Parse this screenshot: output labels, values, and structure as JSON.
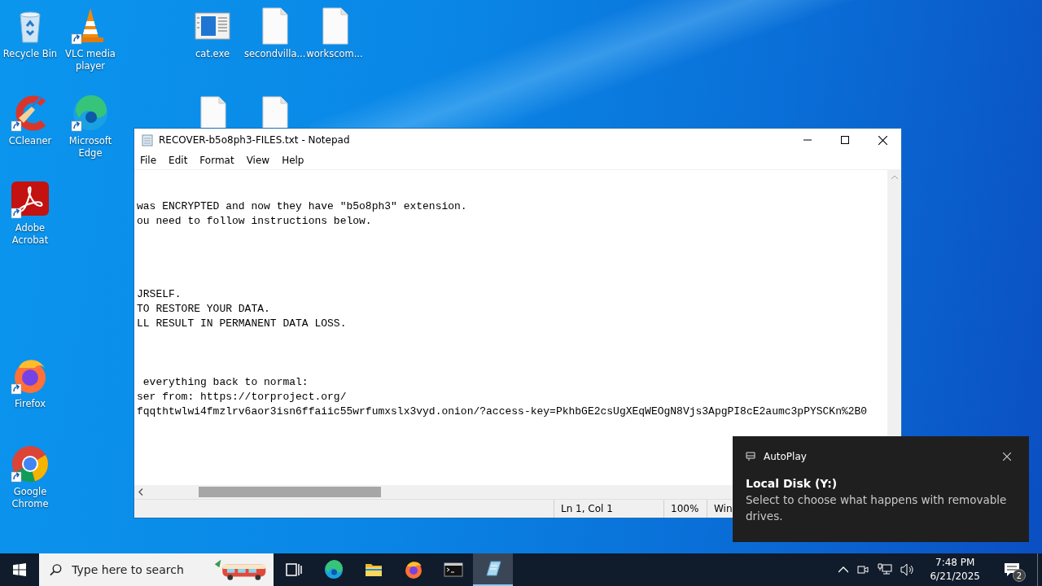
{
  "desktop_icons": [
    {
      "label": "Recycle Bin",
      "kind": "recycle",
      "shortcut": false
    },
    {
      "label": "VLC media player",
      "kind": "vlc",
      "shortcut": true
    },
    {
      "label": "cat.exe",
      "kind": "exe",
      "shortcut": false
    },
    {
      "label": "secondvilla...",
      "kind": "file",
      "shortcut": false
    },
    {
      "label": "workscom...",
      "kind": "file",
      "shortcut": false
    },
    {
      "label": "CCleaner",
      "kind": "ccleaner",
      "shortcut": true
    },
    {
      "label": "Microsoft Edge",
      "kind": "edge",
      "shortcut": true
    },
    {
      "kind": "file",
      "shortcut": false
    },
    {
      "kind": "file",
      "shortcut": false
    },
    {
      "label": "Adobe Acrobat",
      "kind": "acrobat",
      "shortcut": true
    },
    {
      "label": "Firefox",
      "kind": "firefox",
      "shortcut": true
    },
    {
      "label": "Google Chrome",
      "kind": "chrome",
      "shortcut": true
    }
  ],
  "notepad": {
    "title": "RECOVER-b5o8ph3-FILES.txt - Notepad",
    "menu": [
      "File",
      "Edit",
      "Format",
      "View",
      "Help"
    ],
    "text_blocks": [
      [
        "was ENCRYPTED and now they have \"b5o8ph3\" extension.",
        "ou need to follow instructions below."
      ],
      [
        "JRSELF.",
        "TO RESTORE YOUR DATA.",
        "LL RESULT IN PERMANENT DATA LOSS."
      ],
      [
        " everything back to normal:",
        "ser from: https://torproject.org/",
        "fqqthtwlwi4fmzlrv6aor3isn6ffaiic55wrfumxslx3vyd.onion/?access-key=PkhbGE2csUgXEqWEOgN8Vjs3ApgPI8cE2aumc3pPYSCKn%2B0"
      ]
    ],
    "status_bar": {
      "position": "Ln 1, Col 1",
      "zoom": "100%",
      "encoding": "Win"
    }
  },
  "toast": {
    "app": "AutoPlay",
    "title": "Local Disk (Y:)",
    "body": "Select to choose what happens with removable drives."
  },
  "taskbar": {
    "search": {
      "placeholder": "Type here to search"
    },
    "apps": [
      {
        "kind": "taskview",
        "selected": false
      },
      {
        "kind": "edge",
        "selected": false
      },
      {
        "kind": "explorer",
        "selected": false
      },
      {
        "kind": "firefox",
        "selected": false
      },
      {
        "kind": "terminal",
        "selected": false
      },
      {
        "kind": "notepad",
        "selected": true
      }
    ],
    "time": "7:48 PM",
    "date": "6/21/2025",
    "notifications": "2"
  }
}
